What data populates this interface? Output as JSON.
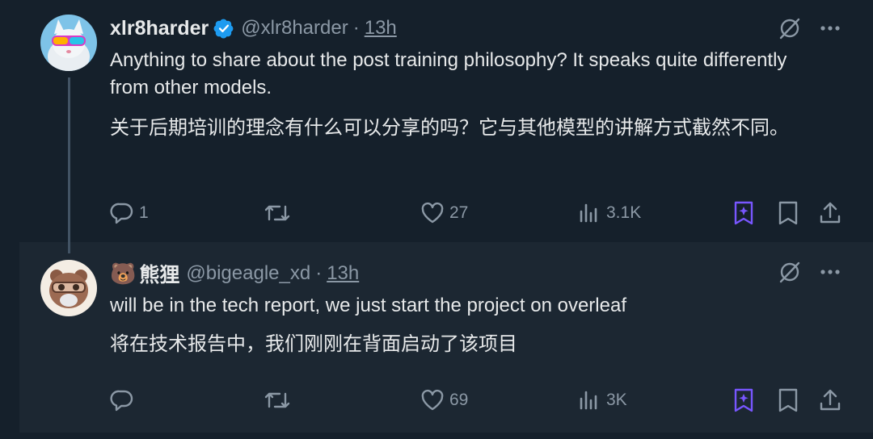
{
  "tweets": [
    {
      "name": "xlr8harder",
      "handle": "@xlr8harder",
      "dot": "·",
      "time": "13h",
      "text_en": "Anything to share about the post training philosophy? It speaks quite differently from other models.",
      "text_zh": "关于后期培训的理念有什么可以分享的吗？它与其他模型的讲解方式截然不同。",
      "replies": "1",
      "likes": "27",
      "views": "3.1K"
    },
    {
      "name_emoji": "🐻",
      "name": "熊狸",
      "handle": "@bigeagle_xd",
      "dot": "·",
      "time": "13h",
      "text_en": "will be in the tech report, we just start the project on overleaf",
      "text_zh": "将在技术报告中，我们刚刚在背面启动了该项目",
      "replies": "",
      "likes": "69",
      "views": "3K"
    }
  ],
  "colors": {
    "background": "#15202b",
    "reply_background": "#1c2732",
    "text": "#e7e9ea",
    "muted": "#8b98a5",
    "verified": "#1d9bf0",
    "grok": "#7856ff"
  },
  "icons": [
    "verified-badge-icon",
    "grok-icon",
    "more-icon",
    "reply-icon",
    "retweet-icon",
    "like-icon",
    "views-icon",
    "grok-bookmark-icon",
    "bookmark-icon",
    "share-icon"
  ]
}
